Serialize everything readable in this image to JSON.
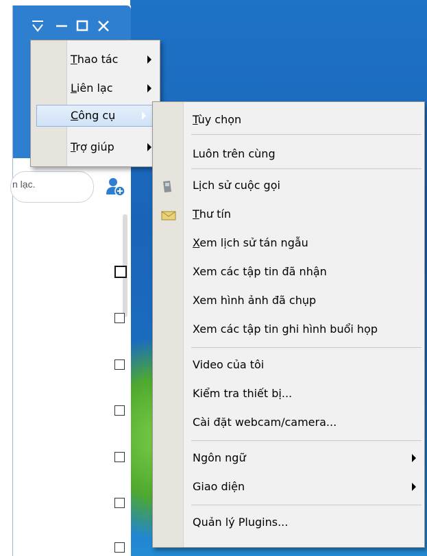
{
  "window": {
    "search_placeholder": "n lạc.",
    "title_icons": [
      "overflow-icon",
      "minimize-icon",
      "maximize-icon",
      "close-icon"
    ]
  },
  "main_menu": {
    "items": [
      {
        "label": "Thao tác",
        "underline": "T",
        "rest": "hao tác",
        "submenu": true
      },
      {
        "label": "Liên lạc",
        "underline": "L",
        "rest": "iên lạc",
        "submenu": true
      },
      {
        "label": "Công cụ",
        "underline": "C",
        "rest": "ông cụ",
        "submenu": true,
        "active": true
      },
      {
        "label": "Trợ giúp",
        "underline": "T",
        "rest": "rợ giúp",
        "submenu": true
      }
    ]
  },
  "tools_menu": {
    "items": [
      {
        "label": "Tùy chọn",
        "underline": "T",
        "rest": "ùy chọn"
      },
      {
        "label": "Luôn trên cùng"
      },
      {
        "label": "Lịch sử cuộc gọi",
        "icon": "phone-icon"
      },
      {
        "label": "Thư tín",
        "underline": "T",
        "rest": "hư tín",
        "icon": "envelope-icon"
      },
      {
        "label": "Xem lịch sử tán ngẫu",
        "underline": "X",
        "rest": "em lịch sử tán ngẫu"
      },
      {
        "label": "Xem các tập tin đã nhận"
      },
      {
        "label": "Xem hình ảnh đã chụp"
      },
      {
        "label": "Xem các tập tin ghi hình buổi họp"
      },
      {
        "label": "Video của tôi"
      },
      {
        "label": "Kiểm tra thiết bị..."
      },
      {
        "label": "Cài đặt webcam/camera..."
      },
      {
        "label": "Ngôn ngữ",
        "submenu": true
      },
      {
        "label": "Giao diện",
        "submenu": true
      },
      {
        "label": "Quản lý Plugins..."
      }
    ]
  }
}
